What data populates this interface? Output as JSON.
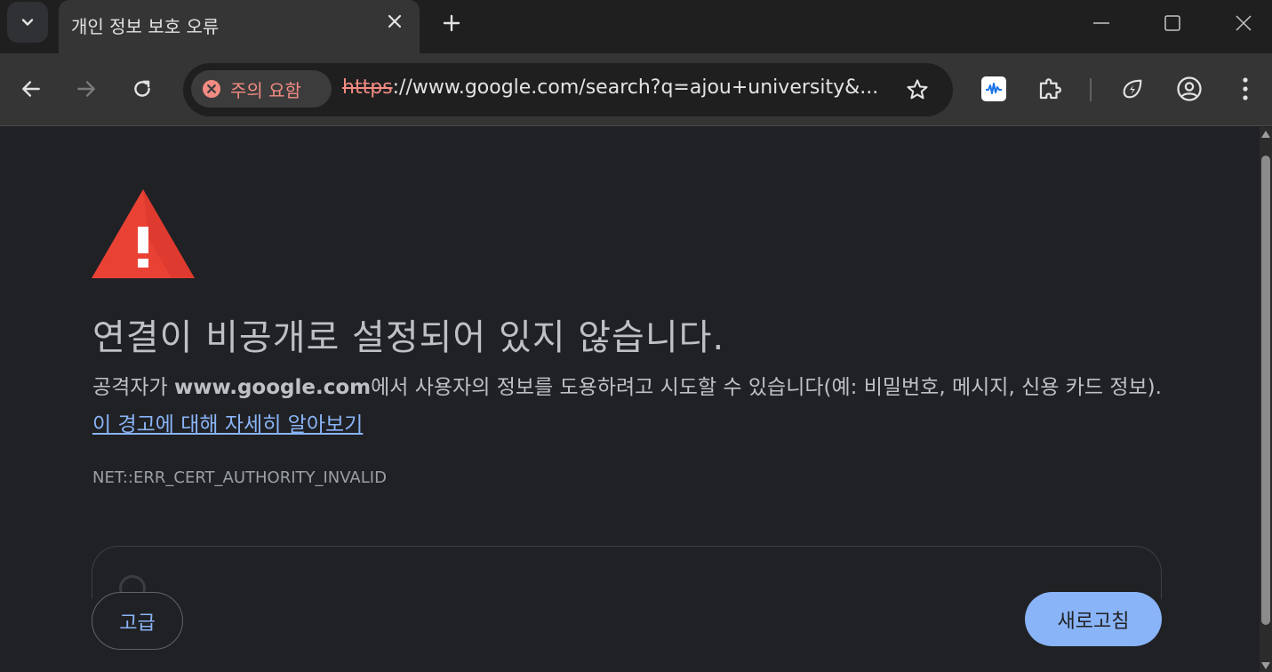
{
  "tab": {
    "title": "개인 정보 보호 오류"
  },
  "omnibox": {
    "security_chip_label": "주의 요함",
    "url_scheme": "https",
    "url_rest_host": "://www.google.com",
    "url_rest_path": "/search?q=ajou+university&..."
  },
  "page": {
    "heading": "연결이 비공개로 설정되어 있지 않습니다.",
    "description_prefix": "공격자가 ",
    "description_host": "www.google.com",
    "description_suffix": "에서 사용자의 정보를 도용하려고 시도할 수 있습니다(예: 비밀번호, 메시지, 신용 카드 정보). ",
    "learn_more_link": "이 경고에 대해 자세히 알아보기",
    "error_code": "NET::ERR_CERT_AUTHORITY_INVALID",
    "advanced_button": "고급",
    "reload_button": "새로고침"
  },
  "colors": {
    "background": "#202124",
    "toolbar": "#353535",
    "warning_red": "#e94235",
    "link_blue": "#8ab4f8",
    "insecure_red": "#f28b82"
  },
  "icons": {
    "tab_search": "chevron-down-icon",
    "tab_close": "close-icon",
    "new_tab": "plus-icon",
    "minimize": "minimize-icon",
    "maximize": "maximize-icon",
    "window_close": "close-icon",
    "back": "arrow-left-icon",
    "forward": "arrow-right-icon",
    "reload": "reload-icon",
    "security": "error-circle-icon",
    "bookmark": "star-icon",
    "extension_1": "wave-extension-icon",
    "extensions": "puzzle-icon",
    "performance": "leaf-bolt-icon",
    "profile": "account-icon",
    "menu": "kebab-menu-icon",
    "warning": "warning-triangle-icon"
  }
}
